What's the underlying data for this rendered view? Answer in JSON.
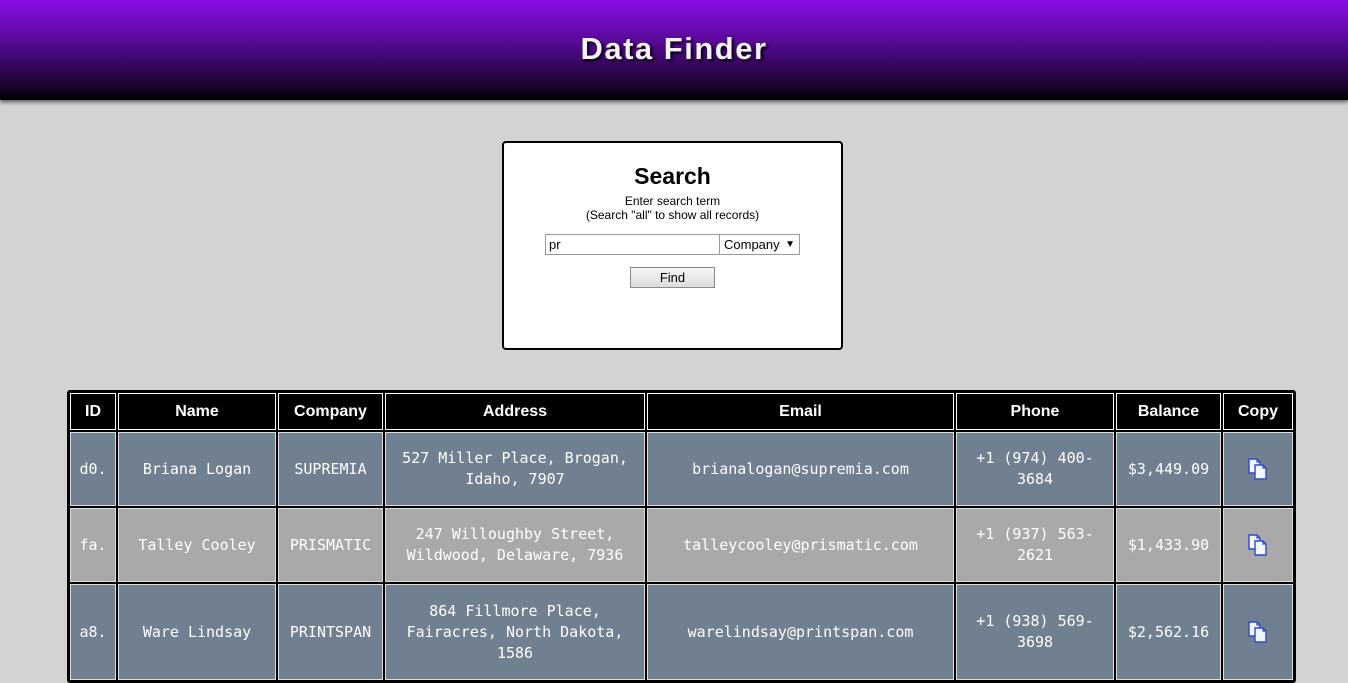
{
  "header": {
    "title": "Data Finder"
  },
  "search": {
    "heading": "Search",
    "hint_line1": "Enter search term",
    "hint_line2": "(Search \"all\" to show all records)",
    "input_value": "pr",
    "field_select": "Company",
    "find_label": "Find"
  },
  "table": {
    "columns": [
      "ID",
      "Name",
      "Company",
      "Address",
      "Email",
      "Phone",
      "Balance",
      "Copy"
    ],
    "rows": [
      {
        "id": "d0.",
        "name": "Briana Logan",
        "company": "SUPREMIA",
        "address": "527 Miller Place, Brogan, Idaho, 7907",
        "email": "brianalogan@supremia.com",
        "phone": "+1 (974) 400-3684",
        "balance": "$3,449.09"
      },
      {
        "id": "fa.",
        "name": "Talley Cooley",
        "company": "PRISMATIC",
        "address": "247 Willoughby Street, Wildwood, Delaware, 7936",
        "email": "talleycooley@prismatic.com",
        "phone": "+1 (937) 563-2621",
        "balance": "$1,433.90"
      },
      {
        "id": "a8.",
        "name": "Ware Lindsay",
        "company": "PRINTSPAN",
        "address": "864 Fillmore Place, Fairacres, North Dakota, 1586",
        "email": "warelindsay@printspan.com",
        "phone": "+1 (938) 569-3698",
        "balance": "$2,562.16"
      }
    ]
  },
  "icons": {
    "copy": "copy-icon",
    "dropdown": "chevron-down-icon"
  },
  "colors": {
    "header_top": "#8a0ee6",
    "row_dark": "#708090",
    "row_light": "#a9a9a9",
    "page_bg": "#d3d3d3"
  }
}
